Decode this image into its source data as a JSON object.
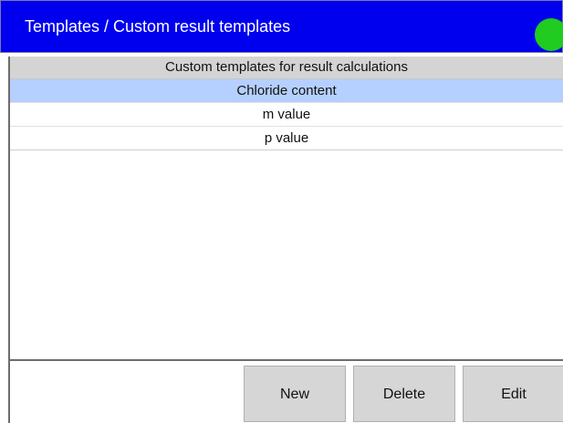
{
  "header": {
    "title": "Templates / Custom result templates",
    "status_icon": "status-indicator-green",
    "status_color": "#1fcc1f",
    "bar_color": "#0000ee"
  },
  "list": {
    "heading": "Custom templates for result calculations",
    "items": [
      {
        "label": "Chloride content",
        "selected": true
      },
      {
        "label": "m value",
        "selected": false
      },
      {
        "label": "p value",
        "selected": false
      }
    ]
  },
  "buttons": {
    "new_label": "New",
    "delete_label": "Delete",
    "edit_label": "Edit"
  }
}
